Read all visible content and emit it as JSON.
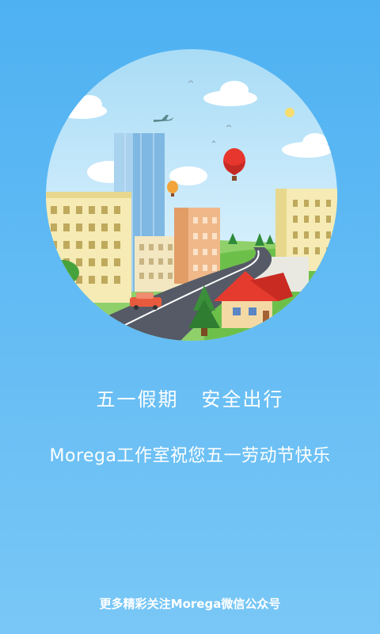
{
  "splash": {
    "headline": "五一假期   安全出行",
    "greeting": "Morega工作室祝您五一劳动节快乐",
    "footer": "更多精彩关注Morega微信公众号"
  },
  "illustration": {
    "subject": "city-scene",
    "colors": {
      "sky": "#d8f0fb",
      "background": "#4eb1f2",
      "road": "#555a66",
      "roof": "#e53b2f",
      "balloon": "#e6362e"
    }
  }
}
